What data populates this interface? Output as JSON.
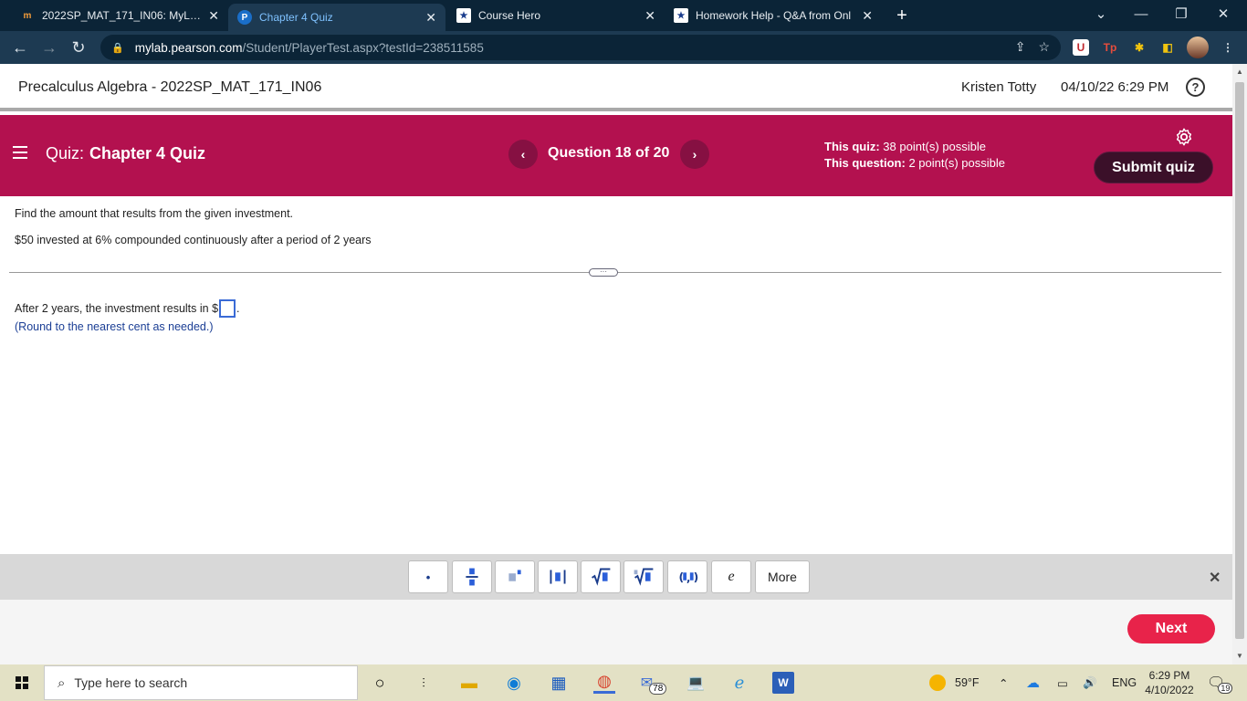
{
  "browser": {
    "tabs": [
      {
        "title": "2022SP_MAT_171_IN06: MyLab M",
        "favicon": "mylab-icon",
        "active": false
      },
      {
        "title": "Chapter 4 Quiz",
        "favicon": "pearson-icon",
        "active": true
      },
      {
        "title": "Course Hero",
        "favicon": "star-icon",
        "active": false
      },
      {
        "title": "Homework Help - Q&A from Onl",
        "favicon": "star-icon",
        "active": false
      }
    ],
    "url_host": "mylab.pearson.com",
    "url_path": "/Student/PlayerTest.aspx?testId=238511585"
  },
  "header": {
    "course_title": "Precalculus Algebra - 2022SP_MAT_171_IN06",
    "user_name": "Kristen Totty",
    "datetime": "04/10/22 6:29 PM"
  },
  "quiz_bar": {
    "quiz_label": "Quiz:",
    "quiz_name": "Chapter 4 Quiz",
    "question_label": "Question 18 of 20",
    "quiz_points_label": "This quiz:",
    "quiz_points_value": "38 point(s) possible",
    "question_points_label": "This question:",
    "question_points_value": "2 point(s) possible",
    "submit_label": "Submit quiz"
  },
  "question": {
    "prompt": "Find the amount that results from the given investment.",
    "given": "$50 invested at 6% compounded continuously after a period of 2 years",
    "answer_prefix": "After 2 years, the investment results in $",
    "answer_suffix": ".",
    "answer_value": "",
    "hint": "(Round to the nearest cent as needed.)"
  },
  "math_tools": {
    "more_label": "More",
    "e_label": "e"
  },
  "footer": {
    "next_label": "Next"
  },
  "taskbar": {
    "search_placeholder": "Type here to search",
    "mail_badge": "78",
    "weather": "59°F",
    "language": "ENG",
    "time": "6:29 PM",
    "date": "4/10/2022",
    "notification_count": "19"
  },
  "colors": {
    "quiz_bar": "#b3114f",
    "submit_button": "#3b1029",
    "next_button": "#e8234a",
    "hint_text": "#1c3f95",
    "browser_frame": "#0b2437"
  }
}
